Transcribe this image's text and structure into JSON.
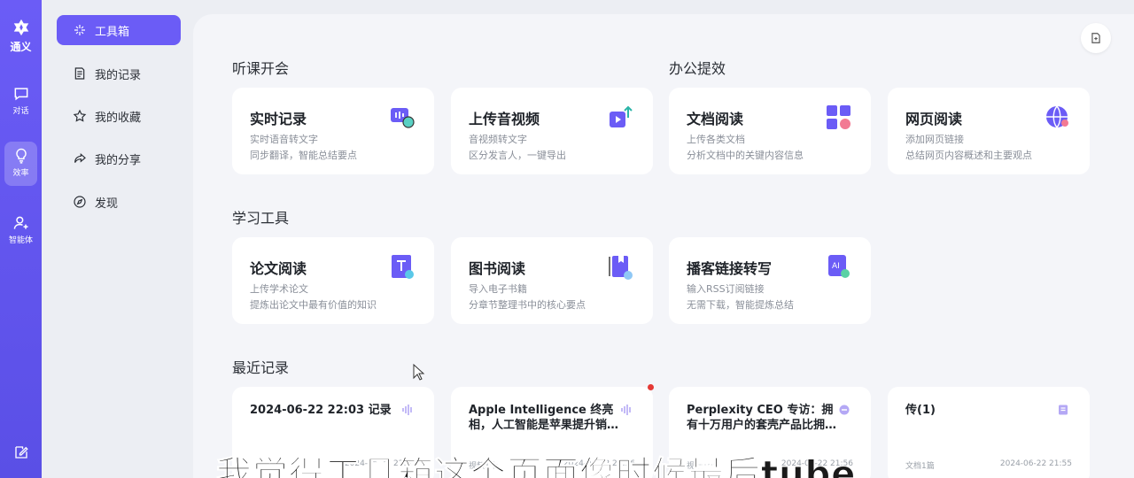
{
  "rail": {
    "logo_label": "通义",
    "items": [
      {
        "label": "对话",
        "icon": "chat-bubble-icon"
      },
      {
        "label": "效率",
        "icon": "lightbulb-icon"
      },
      {
        "label": "智能体",
        "icon": "agent-user-icon"
      }
    ],
    "bottom_icon": "edit-note-icon"
  },
  "sidebar": {
    "items": [
      {
        "label": "工具箱",
        "icon": "toolbox-sparkle-icon",
        "active": true
      },
      {
        "label": "我的记录",
        "icon": "record-file-icon"
      },
      {
        "label": "我的收藏",
        "icon": "star-icon"
      },
      {
        "label": "我的分享",
        "icon": "share-arrow-icon"
      },
      {
        "label": "发现",
        "icon": "compass-icon"
      }
    ]
  },
  "top_button_icon": "document-upload-icon",
  "sections": {
    "lecture": "听课开会",
    "office": "办公提效",
    "study": "学习工具",
    "recent": "最近记录"
  },
  "tools": [
    {
      "title": "实时记录",
      "desc1": "实时语音转文字",
      "desc2": "同步翻译，智能总结要点",
      "icon": "realtime-record-icon"
    },
    {
      "title": "上传音视频",
      "desc1": "音视频转文字",
      "desc2": "区分发言人，一键导出",
      "icon": "upload-video-icon"
    },
    {
      "title": "文档阅读",
      "desc1": "上传各类文档",
      "desc2": "分析文档中的关键内容信息",
      "icon": "document-read-icon"
    },
    {
      "title": "网页阅读",
      "desc1": "添加网页链接",
      "desc2": "总结网页内容概述和主要观点",
      "icon": "web-globe-icon"
    },
    {
      "title": "论文阅读",
      "desc1": "上传学术论文",
      "desc2": "提炼出论文中最有价值的知识",
      "icon": "paper-read-icon"
    },
    {
      "title": "图书阅读",
      "desc1": "导入电子书籍",
      "desc2": "分章节整理书中的核心要点",
      "icon": "book-read-icon"
    },
    {
      "title": "播客链接转写",
      "desc1": "输入RSS订阅链接",
      "desc2": "无需下载，智能提炼总结",
      "icon": "podcast-ai-icon"
    }
  ],
  "recent": [
    {
      "title": "2024-06-22 22:03 记录",
      "meta": "",
      "date": "2024-06-22 22:03",
      "icon": "audio-wave-icon"
    },
    {
      "title": "Apple Intelligence 终亮相，人工智能是苹果提升销…",
      "meta": "视频1个",
      "date": "2024-06-22 21:56",
      "icon": "audio-wave-icon"
    },
    {
      "title": "Perplexity CEO 专访：拥有十万用户的套壳产品比拥…",
      "meta": "视频1个",
      "date": "2024-06-22 21:56",
      "icon": "web-link-icon"
    },
    {
      "title": "传(1)",
      "meta": "文档1篇",
      "date": "2024-06-22 21:55",
      "icon": "doc-small-icon"
    }
  ],
  "video_subtitle": "我觉得工具箱这个页面像时候最后tube",
  "colors": {
    "accent": "#6b5cf6",
    "background": "#f4f5f9",
    "card": "#ffffff"
  }
}
